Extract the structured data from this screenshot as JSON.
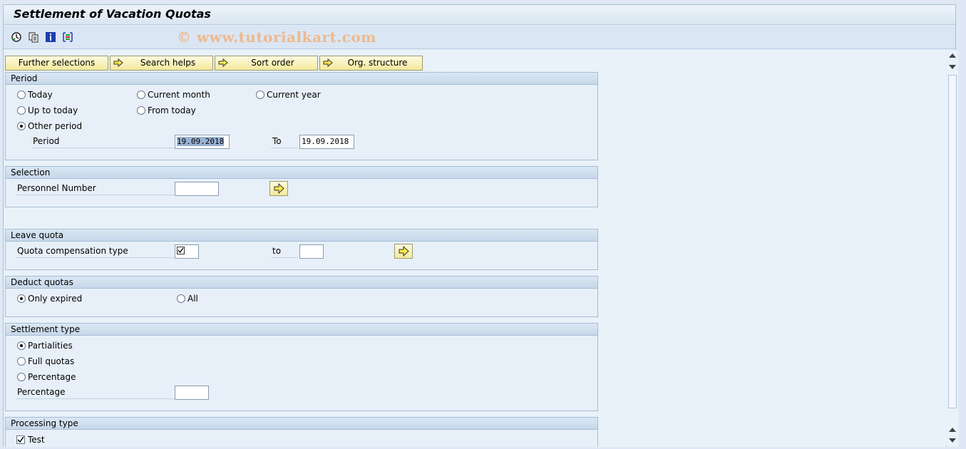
{
  "window": {
    "title": "Settlement of Vacation Quotas",
    "watermark": "© www.tutorialkart.com"
  },
  "toolbar": {
    "icons": [
      "execute-icon",
      "variant-icon",
      "info-icon",
      "selection-options-icon"
    ]
  },
  "buttons": {
    "further_selections": "Further selections",
    "search_helps": "Search helps",
    "sort_order": "Sort order",
    "org_structure": "Org. structure"
  },
  "period": {
    "header": "Period",
    "today": "Today",
    "current_month": "Current month",
    "current_year": "Current year",
    "up_to_today": "Up to today",
    "from_today": "From today",
    "other_period": "Other period",
    "selected": "Other period",
    "period_label": "Period",
    "from_value": "19.09.2018",
    "to_label": "To",
    "to_value": "19.09.2018"
  },
  "selection": {
    "header": "Selection",
    "personnel_number_label": "Personnel Number",
    "personnel_number_value": ""
  },
  "leave_quota": {
    "header": "Leave quota",
    "quota_comp_label": "Quota compensation type",
    "to_label": "to"
  },
  "deduct_quotas": {
    "header": "Deduct quotas",
    "only_expired": "Only expired",
    "all": "All",
    "selected": "Only expired"
  },
  "settlement_type": {
    "header": "Settlement type",
    "partialities": "Partialities",
    "full_quotas": "Full quotas",
    "percentage_option": "Percentage",
    "percentage_label": "Percentage",
    "selected": "Partialities"
  },
  "processing_type": {
    "header": "Processing type",
    "test_label": "Test",
    "test_checked": true
  },
  "colors": {
    "button_fill": "#f4e99c",
    "group_header": "#c7d8ea",
    "background": "#e9f1f9",
    "watermark": "#f0b98c"
  }
}
